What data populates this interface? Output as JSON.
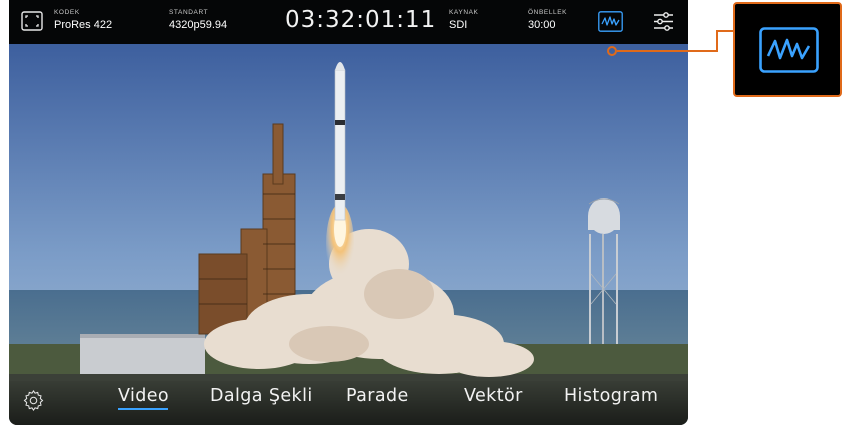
{
  "topbar": {
    "codec_label": "KODEK",
    "codec_value": "ProRes 422",
    "standard_label": "STANDART",
    "standard_value": "4320p59.94",
    "timecode": "03:32:01:11",
    "source_label": "KAYNAK",
    "source_value": "SDI",
    "cache_label": "ÖNBELLEK",
    "cache_value": "30:00"
  },
  "tabs": [
    {
      "label": "Video",
      "selected": true
    },
    {
      "label": "Dalga Şekli",
      "selected": false
    },
    {
      "label": "Parade",
      "selected": false
    },
    {
      "label": "Vektör",
      "selected": false
    },
    {
      "label": "Histogram",
      "selected": false
    }
  ],
  "icons": {
    "fullscreen": "fullscreen-icon",
    "waveform": "waveform-icon",
    "settings_sliders": "sliders-icon",
    "gear": "gear-icon"
  },
  "colors": {
    "accent_blue": "#3aa2ff",
    "callout_orange": "#e06a1a",
    "topbar": "#050607"
  }
}
